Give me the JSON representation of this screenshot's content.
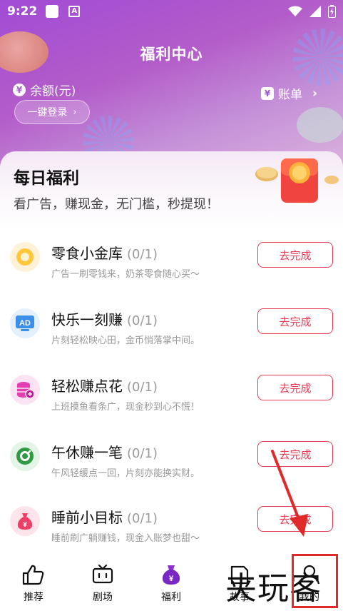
{
  "status_bar": {
    "time": "9:22",
    "a_icon_text": "A"
  },
  "header": {
    "title": "福利中心",
    "balance_label": "余额(元)",
    "login_button": "一键登录",
    "bill_label": "账单",
    "yen_symbol": "¥"
  },
  "section": {
    "title": "每日福利",
    "subtitle": "看广告，赚现金，无门槛，秒提现！"
  },
  "tasks": [
    {
      "title": "零食小金库",
      "progress": "(0/1)",
      "desc": "广告一刷零钱来，奶茶零食随心买～",
      "button": "去完成",
      "icon": "coin-icon"
    },
    {
      "title": "快乐一刻赚",
      "progress": "(0/1)",
      "desc": "片刻轻松映心田，金币悄落掌中间。",
      "button": "去完成",
      "icon": "ad-icon",
      "icon_text": "AD"
    },
    {
      "title": "轻松赚点花",
      "progress": "(0/1)",
      "desc": "上班摸鱼看条广，现金秒到心不慌！",
      "button": "去完成",
      "icon": "database-plus-icon"
    },
    {
      "title": "午休赚一笔",
      "progress": "(0/1)",
      "desc": "午风轻缓点一回，片刻亦能换实财。",
      "button": "去完成",
      "icon": "green-ring-icon"
    },
    {
      "title": "睡前小目标",
      "progress": "(0/1)",
      "desc": "睡前刷广躺赚钱，现金入账梦也甜～",
      "button": "去完成",
      "icon": "money-bag-icon",
      "icon_text": "¥"
    }
  ],
  "bottom_nav": [
    {
      "label": "推荐",
      "icon": "thumbs-up-icon"
    },
    {
      "label": "剧场",
      "icon": "tv-icon"
    },
    {
      "label": "福利",
      "icon": "welfare-bag-icon",
      "icon_text": "¥"
    },
    {
      "label": "故事",
      "icon": "story-icon"
    },
    {
      "label": "我的",
      "icon": "profile-icon"
    }
  ],
  "watermark": "夹玩客",
  "colors": {
    "accent_red": "#ea3b55",
    "header_purple": "#a24bd6",
    "annotation_red": "#e02a2a"
  }
}
